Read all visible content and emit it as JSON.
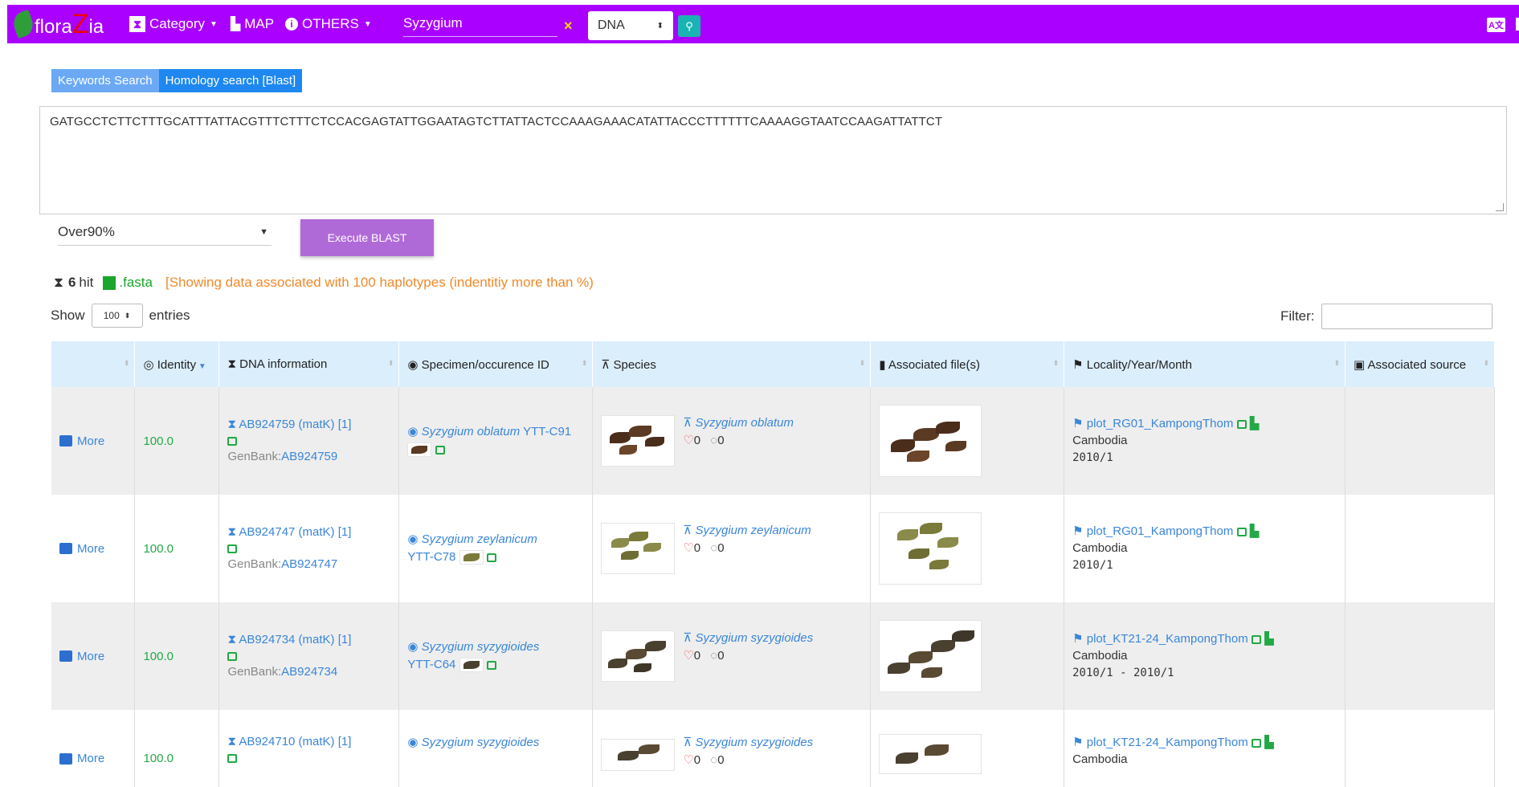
{
  "navbar": {
    "logo_text_1": "flora",
    "logo_text_z": "Z",
    "logo_text_2": "ia",
    "category": "Category",
    "map": "MAP",
    "others": "OTHERS",
    "search_value": "Syzygium",
    "clear": "×",
    "type_select": "DNA",
    "lang": "A文"
  },
  "tabs": {
    "keywords": "Keywords Search",
    "homology": "Homology search [Blast]"
  },
  "sequence": "GATGCCTCTTCTTTGCATTTATTACGTTTCTTTCTCCACGAGTATTGGAATAGTCTTATTACTCCAAAGAAACATATTACCCTTTTTTCAAAAGGTAATCCAAGATTATTCT",
  "identity_select": "Over90%",
  "execute_label": "Execute BLAST",
  "results": {
    "hit_count": "6",
    "hit_label": "hit",
    "fasta_label": ".fasta",
    "note": "[Showing data associated with 100 haplotypes (indentitiy more than %)"
  },
  "table_controls": {
    "show_label": "Show",
    "entries_value": "100",
    "entries_label": "entries",
    "filter_label": "Filter:"
  },
  "columns": {
    "identity": "Identity",
    "dna": "DNA information",
    "specimen": "Specimen/occurence ID",
    "species": "Species",
    "files": "Associated file(s)",
    "locality": "Locality/Year/Month",
    "source": "Associated source"
  },
  "rows": [
    {
      "more": "More",
      "identity": "100.0",
      "dna": "AB924759 (matK) [1]",
      "genbank_label": "GenBank:",
      "genbank": "AB924759",
      "specimen_species": "Syzygium oblatum",
      "specimen_id": "YTT-C91",
      "species": "Syzygium oblatum",
      "likes": "0",
      "comments": "0",
      "locality": "plot_RG01_KampongThom",
      "country": "Cambodia",
      "date": "2010/1"
    },
    {
      "more": "More",
      "identity": "100.0",
      "dna": "AB924747 (matK) [1]",
      "genbank_label": "GenBank:",
      "genbank": "AB924747",
      "specimen_species": "Syzygium zeylanicum",
      "specimen_id": "YTT-C78",
      "species": "Syzygium zeylanicum",
      "likes": "0",
      "comments": "0",
      "locality": "plot_RG01_KampongThom",
      "country": "Cambodia",
      "date": "2010/1"
    },
    {
      "more": "More",
      "identity": "100.0",
      "dna": "AB924734 (matK) [1]",
      "genbank_label": "GenBank:",
      "genbank": "AB924734",
      "specimen_species": "Syzygium syzygioides",
      "specimen_id": "YTT-C64",
      "species": "Syzygium syzygioides",
      "likes": "0",
      "comments": "0",
      "locality": "plot_KT21-24_KampongThom",
      "country": "Cambodia",
      "date": "2010/1 - 2010/1"
    },
    {
      "more": "More",
      "identity": "100.0",
      "dna": "AB924710 (matK) [1]",
      "specimen_species": "Syzygium syzygioides",
      "species": "Syzygium syzygioides",
      "likes": "0",
      "comments": "0",
      "locality": "plot_KT21-24_KampongThom",
      "country": "Cambodia"
    }
  ]
}
